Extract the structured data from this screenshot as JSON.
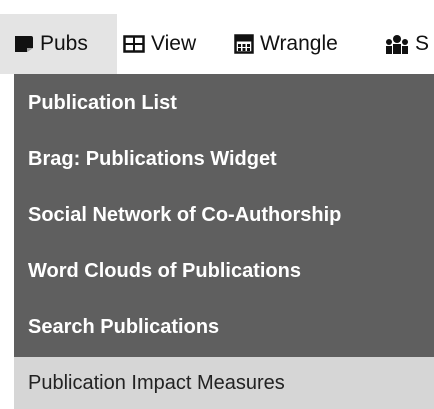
{
  "menubar": {
    "tabs": [
      {
        "label": "Pubs",
        "icon": "book-icon",
        "active": true
      },
      {
        "label": "View",
        "icon": "table-grid-icon"
      },
      {
        "label": "Wrangle",
        "icon": "calculator-icon"
      },
      {
        "label": "S",
        "icon": "people-icon"
      }
    ]
  },
  "dropdown": {
    "items": [
      {
        "label": "Publication List"
      },
      {
        "label": "Brag: Publications Widget"
      },
      {
        "label": "Social Network of Co-Authorship"
      },
      {
        "label": "Word Clouds of Publications"
      },
      {
        "label": "Search Publications"
      },
      {
        "label": "Publication Impact Measures",
        "highlighted": true
      }
    ]
  },
  "colors": {
    "menu_bg": "#5f5f5f",
    "menu_text": "#ffffff",
    "highlight_bg": "#d6d6d6",
    "active_tab_bg": "#e4e4e4"
  }
}
